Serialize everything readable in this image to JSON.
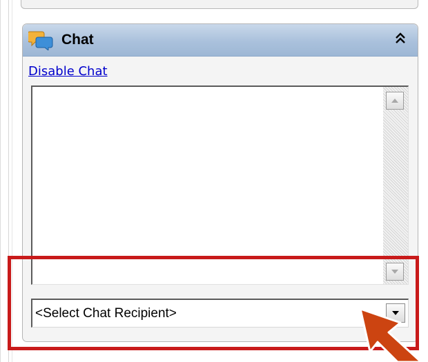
{
  "chat_panel": {
    "title": "Chat",
    "title_icon": "chat-bubbles-icon",
    "collapse_icon": "double-chevron-up-icon",
    "disable_link": "Disable Chat",
    "messages": [],
    "recipient_select": {
      "selected": "<Select Chat Recipient>",
      "dropdown_icon": "triangle-down-icon"
    }
  },
  "annotation": {
    "highlight_color": "#c81a1a",
    "arrow_color": "#cc4411"
  },
  "colors": {
    "header_top": "#c9d8ea",
    "header_bottom": "#9db7d5",
    "link": "#0000cc",
    "panel_bg": "#f4f4f4"
  }
}
